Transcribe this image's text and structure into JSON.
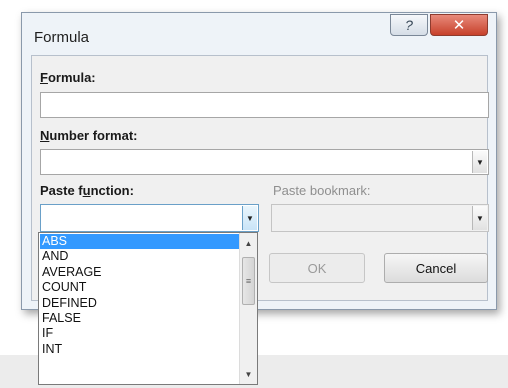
{
  "dialog": {
    "title": "Formula",
    "help_icon": "question-mark-icon",
    "close_icon": "close-icon"
  },
  "formula": {
    "label_prefix": "",
    "label_mnemonic": "F",
    "label_rest": "ormula:",
    "value": ""
  },
  "number_format": {
    "label_mnemonic": "N",
    "label_rest": "umber format:",
    "value": ""
  },
  "paste_function": {
    "label_pre": "Paste f",
    "label_mnemonic": "u",
    "label_rest": "nction:",
    "value": ""
  },
  "paste_bookmark": {
    "label": "Paste bookmark:",
    "value": ""
  },
  "buttons": {
    "ok": "OK",
    "cancel": "Cancel"
  },
  "function_list": {
    "items": [
      "ABS",
      "AND",
      "AVERAGE",
      "COUNT",
      "DEFINED",
      "FALSE",
      "IF",
      "INT"
    ],
    "selected": "ABS"
  },
  "colors": {
    "selection": "#3399ff",
    "close_button": "#c7412b"
  }
}
